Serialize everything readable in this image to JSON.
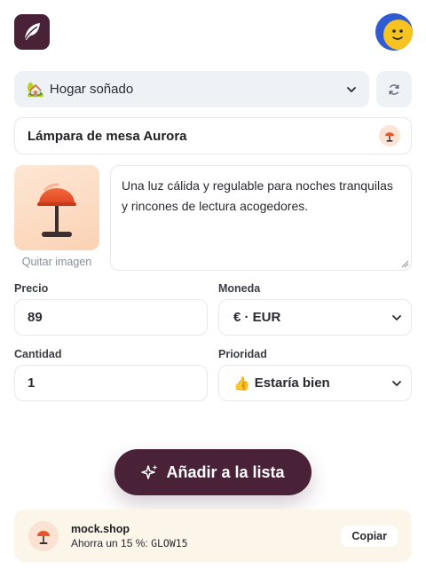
{
  "header": {
    "logo_icon": "feather-logo-icon",
    "avatar_icon": "smiley-avatar-icon",
    "accent_color": "#4a2238"
  },
  "list_selector": {
    "emoji": "🏡",
    "selected": "Hogar soñado",
    "refresh_icon": "refresh-icon"
  },
  "item": {
    "name": "Lámpara de mesa Aurora",
    "name_icon": "lamp-icon",
    "image": "lamp-image",
    "remove_image_label": "Quitar imagen",
    "description": "Una luz cálida y regulable para noches tranquilas y rincones de lectura acogedores."
  },
  "form": {
    "price_label": "Precio",
    "price_value": "89",
    "currency_label": "Moneda",
    "currency_value": "€ · EUR",
    "quantity_label": "Cantidad",
    "quantity_value": "1",
    "priority_label": "Prioridad",
    "priority_emoji": "👍",
    "priority_value": "Estaría bien"
  },
  "cta": {
    "icon": "sparkles-icon",
    "label": "Añadir a la lista"
  },
  "promo": {
    "store": "mock.shop",
    "text": "Ahorra un 15 %: ",
    "code": "GLOW15",
    "copy_label": "Copiar"
  }
}
